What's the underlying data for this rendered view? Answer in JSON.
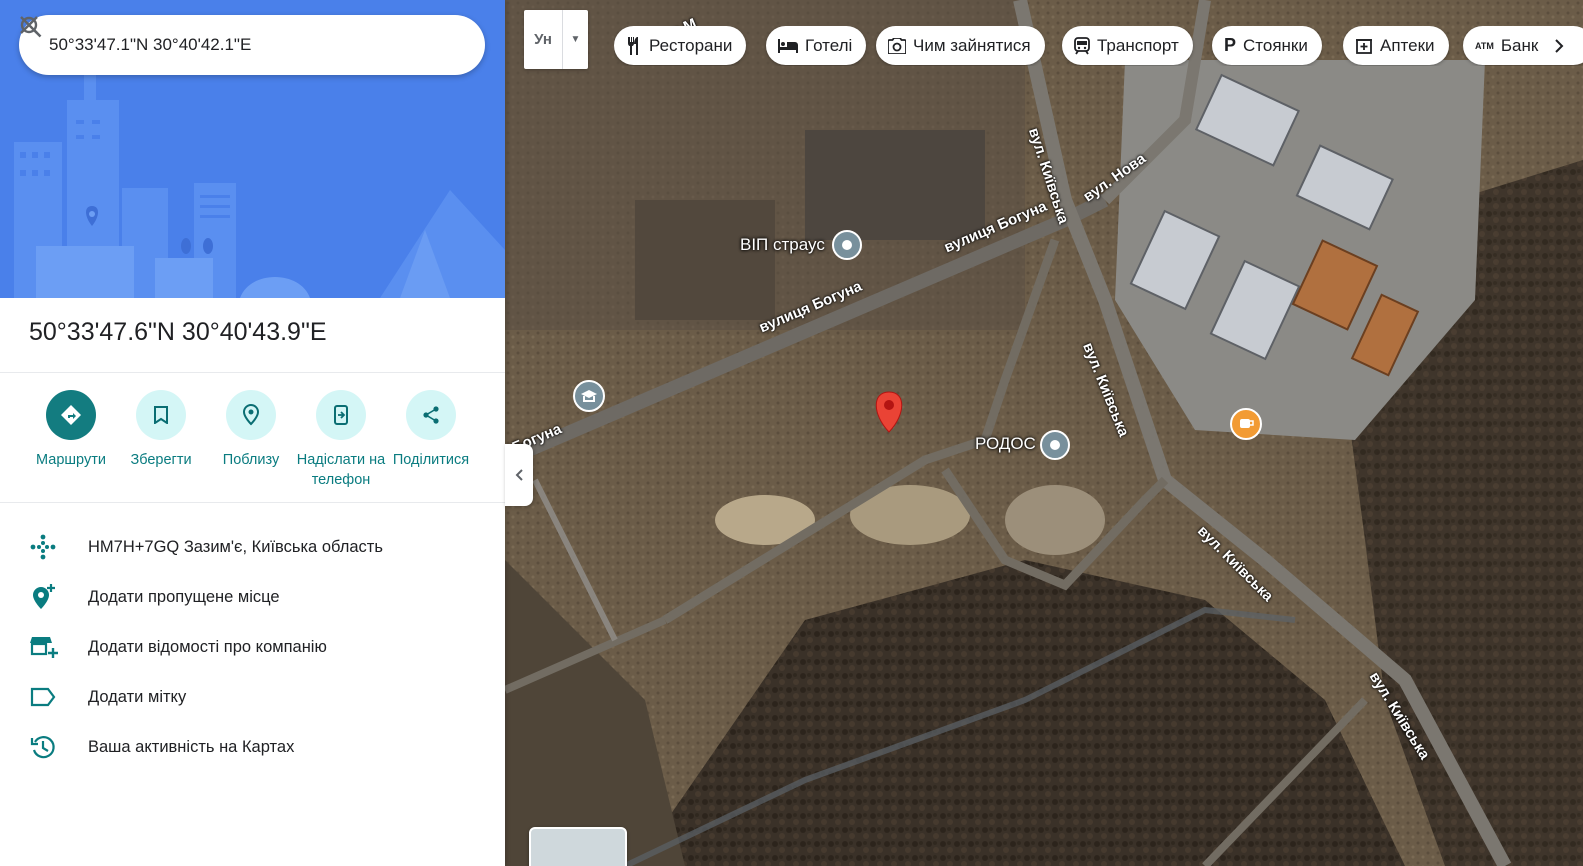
{
  "search": {
    "query": "50°33'47.1\"N 30°40'42.1\"E"
  },
  "place": {
    "title": "50°33'47.6\"N 30°40'43.9\"E"
  },
  "actions": [
    {
      "label": "Маршрути",
      "icon": "directions-icon"
    },
    {
      "label": "Зберегти",
      "icon": "bookmark-icon"
    },
    {
      "label": "Поблизу",
      "icon": "nearby-icon"
    },
    {
      "label": "Надіслати на телефон",
      "icon": "send-to-phone-icon"
    },
    {
      "label": "Поділитися",
      "icon": "share-icon"
    }
  ],
  "info_rows": [
    {
      "text": "HM7H+7GQ Зазим'є, Київська область",
      "icon": "plus-code-icon"
    },
    {
      "text": "Додати пропущене місце",
      "icon": "add-place-icon"
    },
    {
      "text": "Додати відомості про компанію",
      "icon": "add-business-icon"
    },
    {
      "text": "Додати мітку",
      "icon": "label-icon"
    },
    {
      "text": "Ваша активність на Картах",
      "icon": "history-icon"
    }
  ],
  "map": {
    "layer_button": {
      "label": "Ун"
    },
    "chips": [
      {
        "label": "Ресторани",
        "icon": "restaurant-icon"
      },
      {
        "label": "Готелі",
        "icon": "hotel-icon"
      },
      {
        "label": "Чим зайнятися",
        "icon": "camera-icon"
      },
      {
        "label": "Транспорт",
        "icon": "transit-icon"
      },
      {
        "label": "Стоянки",
        "icon": "parking-icon"
      },
      {
        "label": "Аптеки",
        "icon": "pharmacy-icon"
      },
      {
        "label": "Банк",
        "icon": "atm-icon"
      }
    ],
    "streets": [
      {
        "label": "вулиця Богуна"
      },
      {
        "label": "вулиця Богуна"
      },
      {
        "label": "Богуна"
      },
      {
        "label": "вул. Київська"
      },
      {
        "label": "вул. Київська"
      },
      {
        "label": "вул. Київська"
      },
      {
        "label": "вул. Київська"
      },
      {
        "label": "вул. Нова"
      },
      {
        "label": "вулиця М"
      }
    ],
    "pois": [
      {
        "label": "ВІП страус"
      },
      {
        "label": "РОДОС"
      }
    ],
    "colors": {
      "pin": "#ea4335",
      "teal": "#137c80",
      "hero_blue": "#4a80ea"
    }
  }
}
